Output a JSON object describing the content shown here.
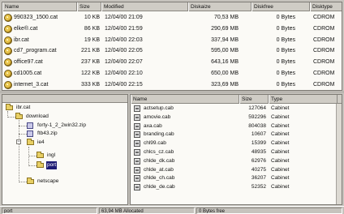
{
  "catalogs": {
    "columns": [
      "Name",
      "Size",
      "Modified",
      "Diskaize",
      "Diskfree",
      "Disktype"
    ],
    "rows": [
      [
        "990323_1500.cat",
        "10 KB",
        "12/04/00 21:09",
        "70,53 MB",
        "0 Bytes",
        "CDROM"
      ],
      [
        "elke®.cat",
        "86 KB",
        "12/04/00 21:59",
        "290,69 MB",
        "0 Bytes",
        "CDROM"
      ],
      [
        "ibr.cat",
        "19 KB",
        "12/04/00 22:03",
        "337,94 MB",
        "0 Bytes",
        "CDROM"
      ],
      [
        "cd7_program.cat",
        "221 KB",
        "12/04/00 22:05",
        "595,00 MB",
        "0 Bytes",
        "CDROM"
      ],
      [
        "office97.cat",
        "237 KB",
        "12/04/00 22:07",
        "643,16 MB",
        "0 Bytes",
        "CDROM"
      ],
      [
        "cd1005.cat",
        "122 KB",
        "12/04/00 22:10",
        "650,00 MB",
        "0 Bytes",
        "CDROM"
      ],
      [
        "internet_3.cat",
        "333 KB",
        "12/04/00 22:15",
        "323,69 MB",
        "0 Bytes",
        "CDROM"
      ]
    ]
  },
  "tree": {
    "nodes": [
      "ibr.cat",
      "download",
      "forty-1_2_2win32.zip",
      "ftb43.zip",
      "ie4",
      "ingl",
      "port",
      "netscape"
    ],
    "selected": "port"
  },
  "files": {
    "columns": [
      "Name",
      "Size",
      "Type"
    ],
    "rows": [
      [
        "actsetup.cab",
        "127064",
        "Cabinet"
      ],
      [
        "amovie.cab",
        "592296",
        "Cabinet"
      ],
      [
        "axa.cab",
        "804038",
        "Cabinet"
      ],
      [
        "branding.cab",
        "10607",
        "Cabinet"
      ],
      [
        "chl99.cab",
        "15399",
        "Cabinet"
      ],
      [
        "chlcs_cz.cab",
        "48935",
        "Cabinet"
      ],
      [
        "chlde_dk.cab",
        "62976",
        "Cabinet"
      ],
      [
        "chlde_at.cab",
        "40275",
        "Cabinet"
      ],
      [
        "chlde_ch.cab",
        "36207",
        "Cabinet"
      ],
      [
        "chlde_de.cab",
        "52352",
        "Cabinet"
      ]
    ]
  },
  "status": {
    "path": "port",
    "allocated": "63,94 MB Allocated",
    "free": "0 Bytes free"
  }
}
